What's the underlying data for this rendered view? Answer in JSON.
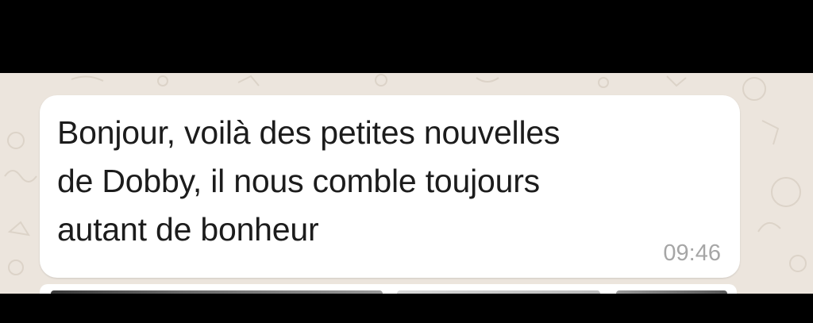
{
  "message": {
    "text_lines": [
      "Bonjour, voilà des petites nouvelles",
      "de Dobby, il nous comble toujours",
      "autant de bonheur"
    ],
    "time": "09:46"
  },
  "colors": {
    "wallpaper": "#ece5dd",
    "bubble": "#ffffff",
    "text": "#1c1c1c",
    "timestamp": "#a6a6a6",
    "bars": "#000000"
  }
}
